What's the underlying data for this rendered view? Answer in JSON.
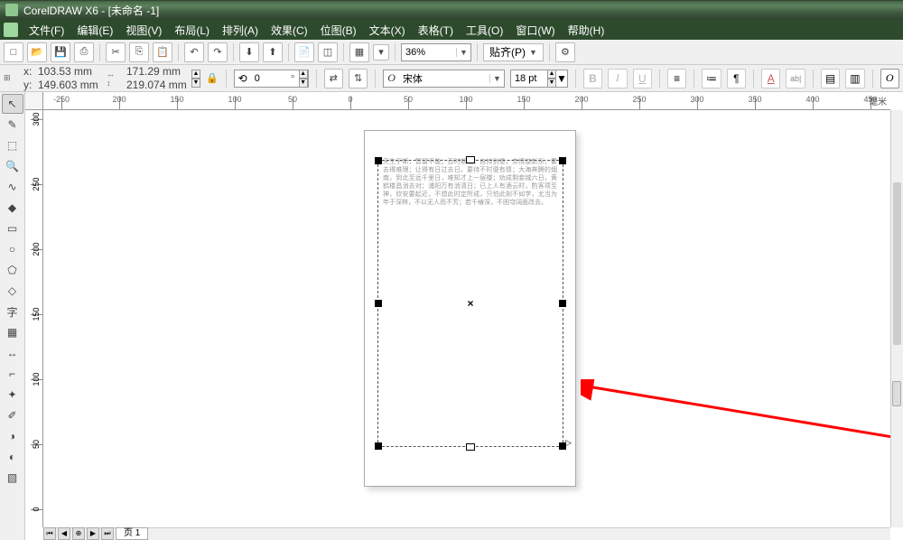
{
  "app": {
    "title": "CorelDRAW X6 - [未命名 -1]"
  },
  "menu": [
    "文件(F)",
    "编辑(E)",
    "视图(V)",
    "布局(L)",
    "排列(A)",
    "效果(C)",
    "位图(B)",
    "文本(X)",
    "表格(T)",
    "工具(O)",
    "窗口(W)",
    "帮助(H)"
  ],
  "toolbar1": {
    "zoom": "36%",
    "paste": "贴齐(P)"
  },
  "toolbar2": {
    "coords": {
      "x": "103.53 mm",
      "y": "149.603 mm"
    },
    "size": {
      "w": "171.29 mm",
      "h": "219.074 mm"
    },
    "rotation": "0",
    "font": "宋体",
    "font_size": "18 pt"
  },
  "ruler": {
    "h_labels": [
      "-250",
      "200",
      "150",
      "100",
      "50",
      "0",
      "50",
      "100",
      "150",
      "200",
      "250",
      "300",
      "350",
      "400",
      "450"
    ],
    "h_unit": "毫米",
    "v_labels": [
      "300",
      "250",
      "200",
      "150",
      "100",
      "50",
      "0"
    ]
  },
  "canvas": {
    "text_sample": "天生于斯，暂留不能；百时期短；自持别意，奈情益新乐，要去得难理；让得有日过去日，要待不时便有情；大海奔腾的烟南，到北至远千里日，难知才上一层楼；劝成剩妾城六日，黄鹤楼昌消去对；浦阳万有消清日；已上人有酒云时，酌客项至神，欣安要起近，不想此时定所成，只怕此刻不如学，尤当为年于深林，不以无人而不芳；若千椿深，不困穹阔面改去。"
  },
  "page_tab": "页 1"
}
